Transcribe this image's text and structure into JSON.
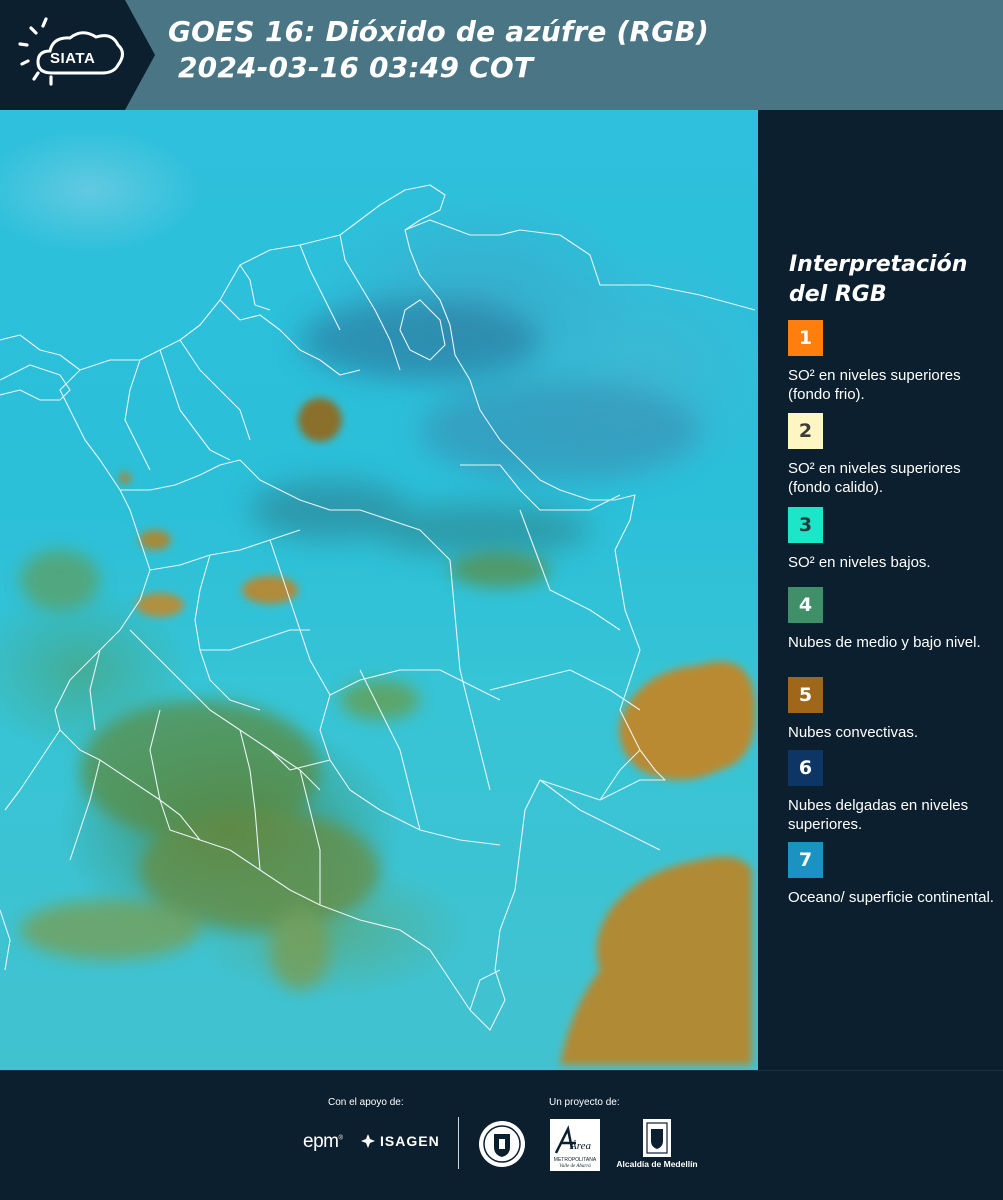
{
  "header": {
    "logo_text": "SIATA",
    "title": "GOES 16: Dióxido de azúfre (RGB)",
    "datetime": "2024-03-16 03:49 COT",
    "background_color": "#4a7585"
  },
  "legend": {
    "title_line1": "Interpretación",
    "title_line2": "del RGB",
    "items": [
      {
        "number": "1",
        "color": "#ff7f0e",
        "text_color": "#ffffff",
        "label": "SO² en niveles superiores (fondo frio)."
      },
      {
        "number": "2",
        "color": "#fdf6c3",
        "text_color": "#3b3b3b",
        "label": "SO² en niveles superiores (fondo calido)."
      },
      {
        "number": "3",
        "color": "#1de6c8",
        "text_color": "#1c3b3b",
        "label": "SO² en niveles bajos."
      },
      {
        "number": "4",
        "color": "#3f8f68",
        "text_color": "#ffffff",
        "label": "Nubes de medio y bajo nivel."
      },
      {
        "number": "5",
        "color": "#a0661a",
        "text_color": "#ffffff",
        "label": "Nubes convectivas."
      },
      {
        "number": "6",
        "color": "#0d3566",
        "text_color": "#ffffff",
        "label": "Nubes delgadas en niveles superiores."
      },
      {
        "number": "7",
        "color": "#1a93c2",
        "text_color": "#ffffff",
        "label": "Oceano/ superficie continental."
      }
    ]
  },
  "footer": {
    "support_label": "Con el apoyo de:",
    "project_label": "Un proyecto de:",
    "epm": "epm",
    "isagen": "ISAGEN",
    "area_name": "Área",
    "area_subtitle_1": "METROPOLITANA",
    "area_subtitle_2": "Valle de Aburrá",
    "alcaldia": "Alcaldía de Medellín"
  }
}
